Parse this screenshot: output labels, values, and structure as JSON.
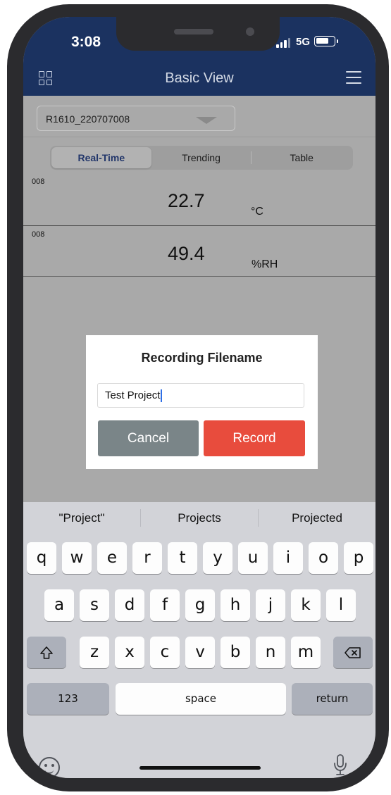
{
  "status_bar": {
    "time": "3:08",
    "network": "5G"
  },
  "nav": {
    "title": "Basic View",
    "left_icon": "grid-icon",
    "right_icon": "menu-icon"
  },
  "device_select": {
    "value": "R1610_220707008"
  },
  "tabs": [
    {
      "label": "Real-Time",
      "active": true
    },
    {
      "label": "Trending",
      "active": false
    },
    {
      "label": "Table",
      "active": false
    }
  ],
  "readings": [
    {
      "channel": "008",
      "value": "22.7",
      "unit": "°C"
    },
    {
      "channel": "008",
      "value": "49.4",
      "unit": "%RH"
    }
  ],
  "dialog": {
    "title": "Recording Filename",
    "input_value": "Test Project",
    "cancel_label": "Cancel",
    "record_label": "Record"
  },
  "keyboard": {
    "suggestions": [
      "\"Project\"",
      "Projects",
      "Projected"
    ],
    "row1": [
      "q",
      "w",
      "e",
      "r",
      "t",
      "y",
      "u",
      "i",
      "o",
      "p"
    ],
    "row2": [
      "a",
      "s",
      "d",
      "f",
      "g",
      "h",
      "j",
      "k",
      "l"
    ],
    "row3": [
      "z",
      "x",
      "c",
      "v",
      "b",
      "n",
      "m"
    ],
    "shift_icon": "shift-icon",
    "backspace_icon": "backspace-icon",
    "numbers_label": "123",
    "space_label": "space",
    "return_label": "return",
    "emoji_icon": "emoji-icon",
    "mic_icon": "microphone-icon"
  },
  "colors": {
    "header": "#1b3260",
    "record_button": "#e84c3d",
    "cancel_button": "#7a8588"
  }
}
